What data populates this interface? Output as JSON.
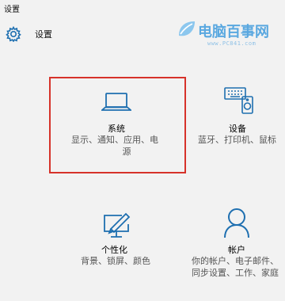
{
  "window": {
    "title": "设置"
  },
  "header": {
    "title": "设置",
    "icon": "gear-icon"
  },
  "watermark": {
    "brand": "电脑百事网",
    "url": "www.PC841.com"
  },
  "accent_color": "#1e6fb0",
  "highlight_color": "#d6322a",
  "tiles": [
    {
      "label": "系统",
      "desc_line1": "显示、通知、应用、电",
      "desc_line2": "源",
      "icon": "laptop-icon",
      "selected": true
    },
    {
      "label": "设备",
      "desc_line1": "蓝牙、打印机、鼠标",
      "icon": "devices-icon"
    },
    {
      "label": "个性化",
      "desc_line1": "背景、锁屏、颜色",
      "icon": "personalization-icon"
    },
    {
      "label": "帐户",
      "desc_line1": "你的帐户、电子邮件、",
      "desc_line2": "同步设置、工作、家庭",
      "icon": "account-icon"
    }
  ]
}
